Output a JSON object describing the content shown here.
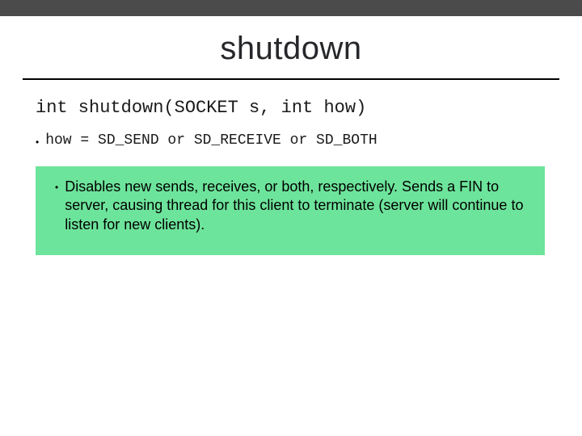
{
  "title": "shutdown",
  "signature": "int shutdown(SOCKET s, int how)",
  "how_line": "how = SD_SEND or SD_RECEIVE or SD_BOTH",
  "description": "Disables new sends, receives, or both, respectively. Sends a FIN to server, causing thread for this client to terminate (server will continue to listen for new clients)."
}
